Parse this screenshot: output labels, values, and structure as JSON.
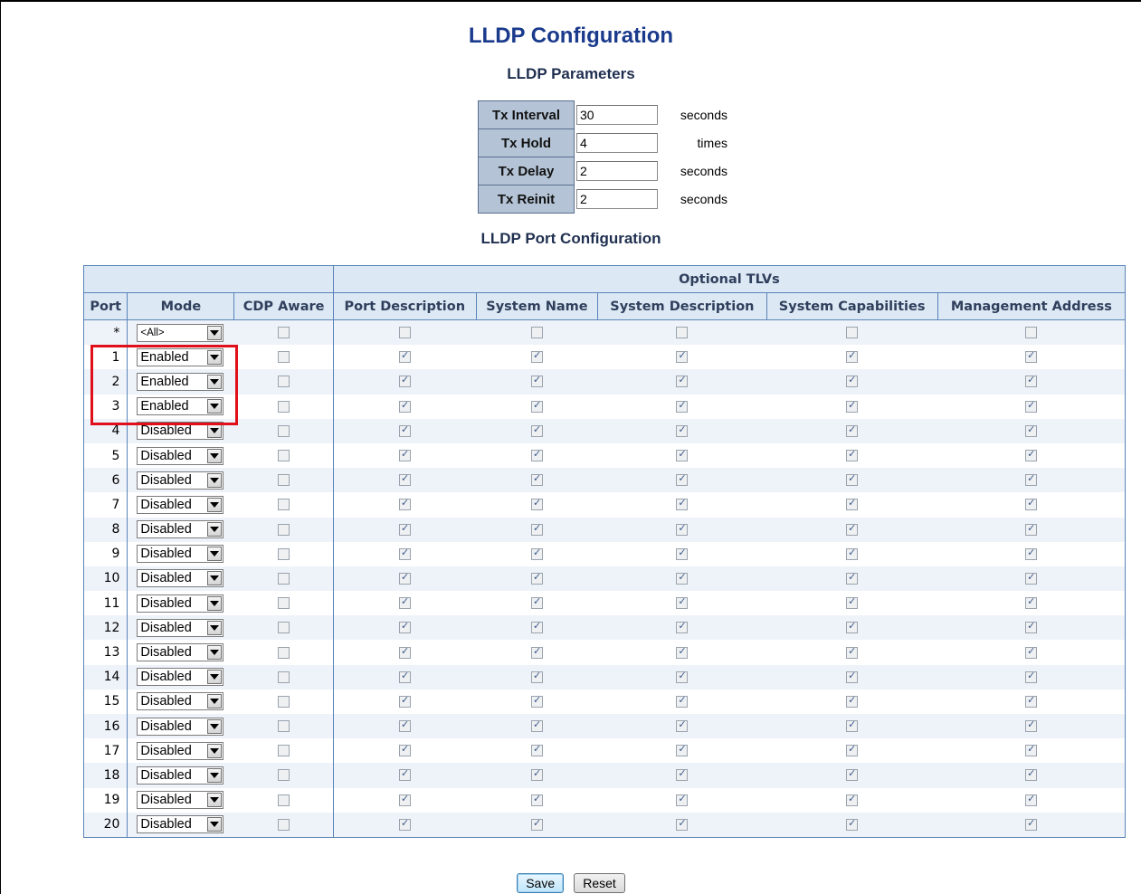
{
  "page": {
    "title": "LLDP Configuration",
    "params_title": "LLDP Parameters",
    "ports_title": "LLDP Port Configuration"
  },
  "params": [
    {
      "label": "Tx Interval",
      "value": "30",
      "unit": "seconds"
    },
    {
      "label": "Tx Hold",
      "value": "4",
      "unit": "times"
    },
    {
      "label": "Tx Delay",
      "value": "2",
      "unit": "seconds"
    },
    {
      "label": "Tx Reinit",
      "value": "2",
      "unit": "seconds"
    }
  ],
  "ports_table": {
    "group_header": "Optional TLVs",
    "columns": [
      "Port",
      "Mode",
      "CDP Aware",
      "Port Description",
      "System Name",
      "System Description",
      "System Capabilities",
      "Management Address"
    ],
    "all_row": {
      "port": "*",
      "mode": "<All>",
      "cdp": false,
      "tlvs": [
        false,
        false,
        false,
        false,
        false
      ]
    },
    "rows": [
      {
        "port": "1",
        "mode": "Enabled",
        "cdp": false,
        "tlvs": [
          true,
          true,
          true,
          true,
          true
        ]
      },
      {
        "port": "2",
        "mode": "Enabled",
        "cdp": false,
        "tlvs": [
          true,
          true,
          true,
          true,
          true
        ]
      },
      {
        "port": "3",
        "mode": "Enabled",
        "cdp": false,
        "tlvs": [
          true,
          true,
          true,
          true,
          true
        ]
      },
      {
        "port": "4",
        "mode": "Disabled",
        "cdp": false,
        "tlvs": [
          true,
          true,
          true,
          true,
          true
        ]
      },
      {
        "port": "5",
        "mode": "Disabled",
        "cdp": false,
        "tlvs": [
          true,
          true,
          true,
          true,
          true
        ]
      },
      {
        "port": "6",
        "mode": "Disabled",
        "cdp": false,
        "tlvs": [
          true,
          true,
          true,
          true,
          true
        ]
      },
      {
        "port": "7",
        "mode": "Disabled",
        "cdp": false,
        "tlvs": [
          true,
          true,
          true,
          true,
          true
        ]
      },
      {
        "port": "8",
        "mode": "Disabled",
        "cdp": false,
        "tlvs": [
          true,
          true,
          true,
          true,
          true
        ]
      },
      {
        "port": "9",
        "mode": "Disabled",
        "cdp": false,
        "tlvs": [
          true,
          true,
          true,
          true,
          true
        ]
      },
      {
        "port": "10",
        "mode": "Disabled",
        "cdp": false,
        "tlvs": [
          true,
          true,
          true,
          true,
          true
        ]
      },
      {
        "port": "11",
        "mode": "Disabled",
        "cdp": false,
        "tlvs": [
          true,
          true,
          true,
          true,
          true
        ]
      },
      {
        "port": "12",
        "mode": "Disabled",
        "cdp": false,
        "tlvs": [
          true,
          true,
          true,
          true,
          true
        ]
      },
      {
        "port": "13",
        "mode": "Disabled",
        "cdp": false,
        "tlvs": [
          true,
          true,
          true,
          true,
          true
        ]
      },
      {
        "port": "14",
        "mode": "Disabled",
        "cdp": false,
        "tlvs": [
          true,
          true,
          true,
          true,
          true
        ]
      },
      {
        "port": "15",
        "mode": "Disabled",
        "cdp": false,
        "tlvs": [
          true,
          true,
          true,
          true,
          true
        ]
      },
      {
        "port": "16",
        "mode": "Disabled",
        "cdp": false,
        "tlvs": [
          true,
          true,
          true,
          true,
          true
        ]
      },
      {
        "port": "17",
        "mode": "Disabled",
        "cdp": false,
        "tlvs": [
          true,
          true,
          true,
          true,
          true
        ]
      },
      {
        "port": "18",
        "mode": "Disabled",
        "cdp": false,
        "tlvs": [
          true,
          true,
          true,
          true,
          true
        ]
      },
      {
        "port": "19",
        "mode": "Disabled",
        "cdp": false,
        "tlvs": [
          true,
          true,
          true,
          true,
          true
        ]
      },
      {
        "port": "20",
        "mode": "Disabled",
        "cdp": false,
        "tlvs": [
          true,
          true,
          true,
          true,
          true
        ]
      }
    ]
  },
  "buttons": {
    "save": "Save",
    "reset": "Reset"
  },
  "colors": {
    "title": "#1a3a8c",
    "highlight": "#e0101a",
    "header_bg": "#dce8f4",
    "param_label_bg": "#b4c4d6"
  }
}
